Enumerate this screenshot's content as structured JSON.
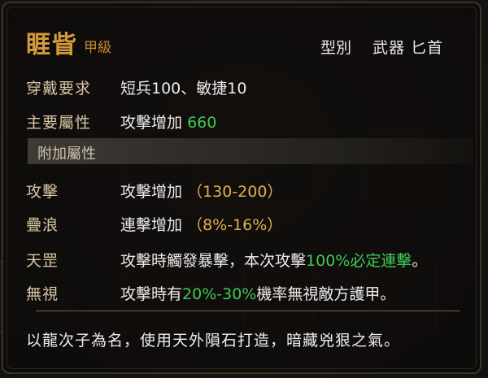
{
  "item": {
    "name": "睚眥",
    "grade": "甲級",
    "type_label": "型別",
    "type_value": "武器 匕首"
  },
  "requirements": {
    "label": "穿戴要求",
    "value": "短兵100、敏捷10"
  },
  "main_attribute": {
    "label": "主要屬性",
    "text": "攻擊增加",
    "value": "660"
  },
  "extra_section": {
    "title": "附加屬性"
  },
  "extra_attributes": [
    {
      "label": "攻擊",
      "text": "攻擊增加",
      "value": "（130-200）"
    },
    {
      "label": "疊浪",
      "text": "連擊增加",
      "value": "（8%-16%）"
    },
    {
      "label": "天罡",
      "text": "攻擊時觸發暴擊，本次攻擊",
      "highlight": "100%必定連擊",
      "suffix": "。"
    },
    {
      "label": "無視",
      "text": "攻擊時有",
      "highlight": "20%-30%",
      "suffix": "機率無視敵方護甲。"
    }
  ],
  "lore": "以龍次子為名，使用天外隕石打造，暗藏兇狠之氣。",
  "colors": {
    "name": "#d39a3a",
    "green": "#3ecb54",
    "gold": "#e0b050",
    "label": "#d9c6a2"
  }
}
